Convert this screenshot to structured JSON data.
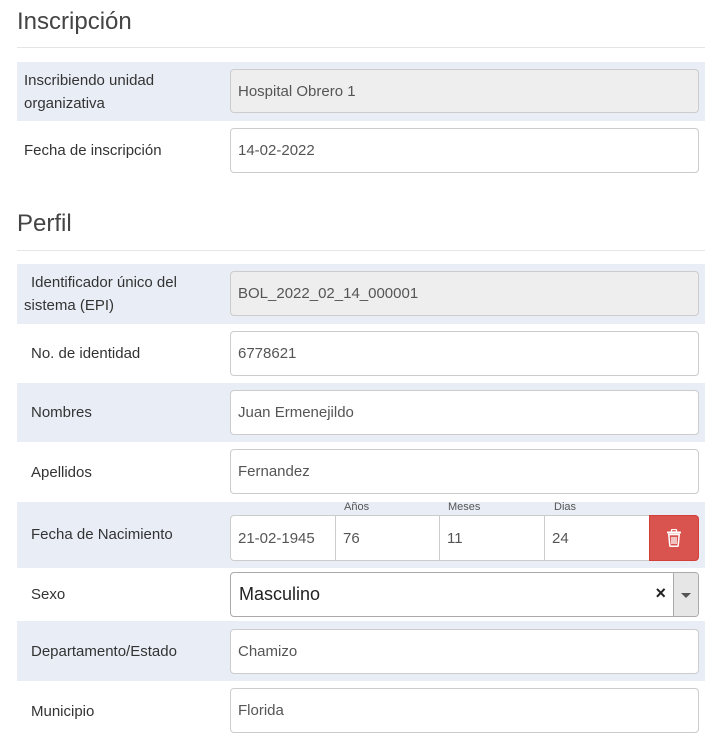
{
  "inscripcion": {
    "title": "Inscripción",
    "unidad_label_line1": "Inscribiendo unidad",
    "unidad_label_line2": "organizativa",
    "unidad_value": "Hospital Obrero 1",
    "fecha_label": "Fecha de inscripción",
    "fecha_value": "14-02-2022"
  },
  "perfil": {
    "title": "Perfil",
    "epi_label_line1": "Identificador único del",
    "epi_label_line2": "sistema (EPI)",
    "epi_value": "BOL_2022_02_14_000001",
    "identidad_label": "No. de identidad",
    "identidad_value": "6778621",
    "nombres_label": "Nombres",
    "nombres_value": "Juan Ermenejildo",
    "apellidos_label": "Apellidos",
    "apellidos_value": "Fernandez",
    "nacimiento_label": "Fecha de Nacimiento",
    "nacimiento_value": "21-02-1945",
    "anios_label": "Años",
    "anios_value": "76",
    "meses_label": "Meses",
    "meses_value": "11",
    "dias_label": "Dias",
    "dias_value": "24",
    "sexo_label": "Sexo",
    "sexo_value": "Masculino",
    "sexo_clear": "×",
    "departamento_label": "Departamento/Estado",
    "departamento_value": "Chamizo",
    "municipio_label": "Municipio",
    "municipio_value": "Florida"
  },
  "icons": {
    "delete": "trash-icon",
    "clear": "clear-icon",
    "dropdown": "caret-down-icon"
  },
  "colors": {
    "row_shade": "#e9eef6",
    "delete_button": "#d9534f",
    "readonly_field": "#eeeeee"
  }
}
